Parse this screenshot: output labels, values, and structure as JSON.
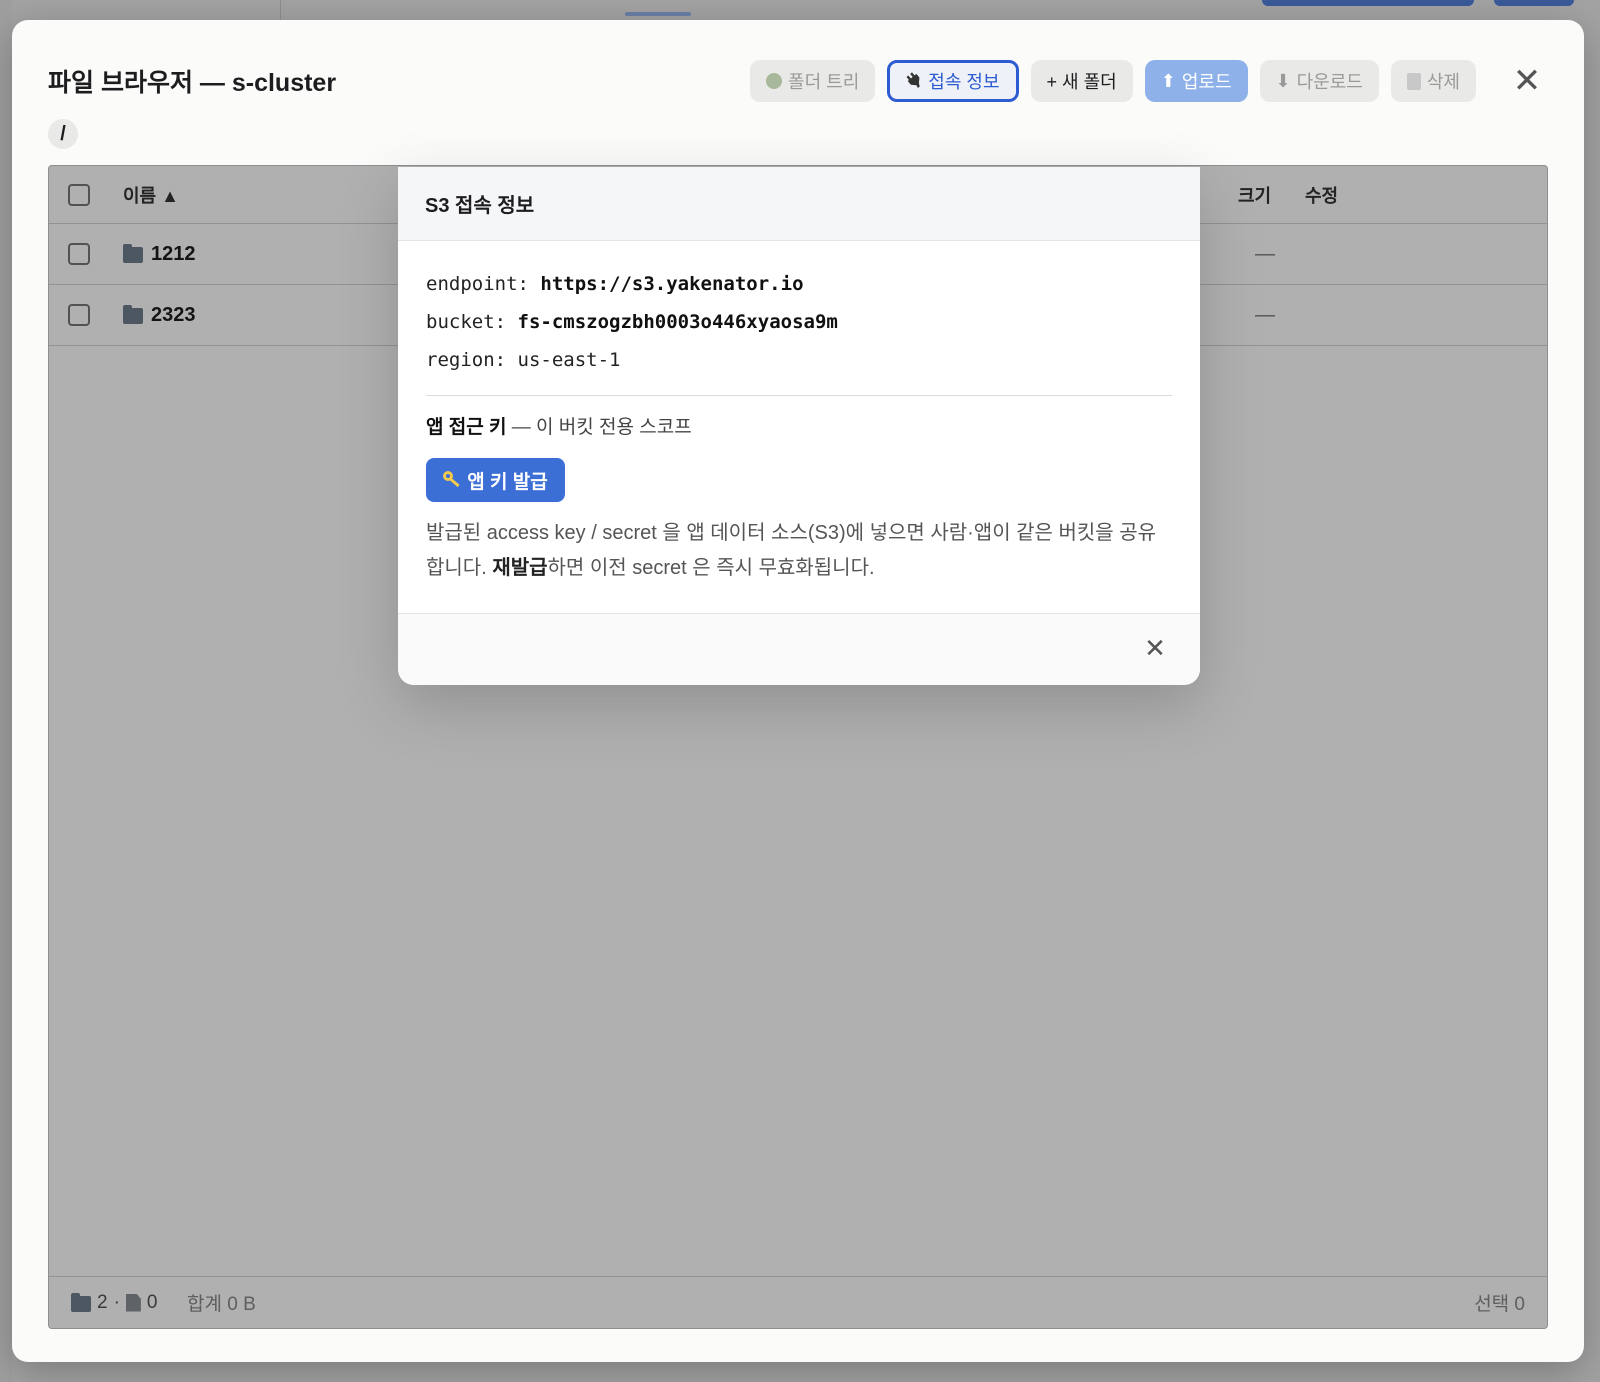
{
  "modal": {
    "title": "파일 브라우저 — s-cluster",
    "breadcrumb": "/",
    "toolbar": {
      "folder_tree": "폴더 트리",
      "connection_info": "접속 정보",
      "new_folder": "+ 새 폴더",
      "upload": "업로드",
      "download": "다운로드",
      "delete": "삭제",
      "upload_arrow": "⬆",
      "download_arrow": "⬇"
    },
    "close": "✕"
  },
  "table": {
    "columns": {
      "name": "이름 ▲",
      "size": "크기",
      "modified": "수정"
    },
    "rows": [
      {
        "name": "1212",
        "size": "—"
      },
      {
        "name": "2323",
        "size": "—"
      }
    ],
    "footer": {
      "folders": "2",
      "separator": "·",
      "files": "0",
      "total": "합계 0 B",
      "selected": "선택 0"
    }
  },
  "popover": {
    "title": "S3 접속 정보",
    "endpoint_label": "endpoint:",
    "endpoint_value": "https://s3.yakenator.io",
    "bucket_label": "bucket:",
    "bucket_value": "fs-cmszogzbh0003o446xyaosa9m",
    "region_label": "region:",
    "region_value": "us-east-1",
    "appkey_title": "앱 접근 키",
    "appkey_suffix": " — 이 버킷 전용 스코프",
    "issue_button": "앱 키 발급",
    "desc_part1": "발급된 access key / secret 을 앱 데이터 소스(S3)에 넣으면 사람·앱이 같은 버킷을 공유합니다. ",
    "desc_bold": "재발급",
    "desc_part2": "하면 이전 secret 은 즉시 무효화됩니다.",
    "close": "✕"
  }
}
